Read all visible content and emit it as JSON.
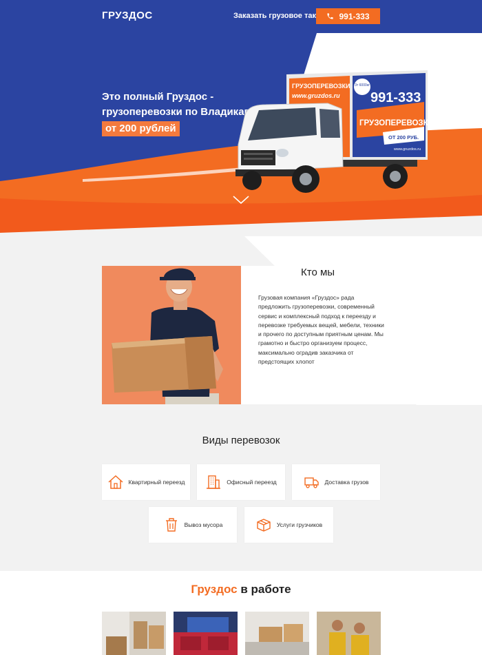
{
  "header": {
    "logo": "ГРУЗДОС",
    "order_link": "Заказать грузовое такси",
    "phone": "991-333"
  },
  "hero": {
    "title_line1": "Это полный Груздос -",
    "title_line2": "грузоперевозки по Владикавказу",
    "price": "от 200 рублей",
    "truck": {
      "side_label": "ГРУЗОПЕРЕВОЗКИ",
      "site": "www.gruzdos.ru",
      "phone": "991-333",
      "big_label": "ГРУЗОПЕРЕВОЗКИ",
      "price": "ОТ 200 РУБ.",
      "site_small": "www.gruzdos.ru",
      "badge": "3т 6000кг"
    }
  },
  "about": {
    "title": "Кто мы",
    "text": "Грузовая компания «Груздос» рада предложить грузоперевозки, современный сервис и комплексный подход к переезду и перевозке требуемых вещей, мебели, техники и прочего по доступным приятным ценам. Мы грамотно и быстро организуем процесс, максимально оградив заказчика от предстоящих хлопот"
  },
  "services": {
    "title": "Виды перевозок",
    "items": [
      {
        "label": "Квартирный переезд",
        "icon": "house-icon"
      },
      {
        "label": "Офисный переезд",
        "icon": "office-building-icon"
      },
      {
        "label": "Доставка грузов",
        "icon": "delivery-truck-icon"
      },
      {
        "label": "Вывоз мусора",
        "icon": "trash-can-icon"
      },
      {
        "label": "Услуги грузчиков",
        "icon": "box-icon"
      }
    ]
  },
  "work": {
    "title_accent": "Груздос",
    "title_rest": " в работе"
  },
  "colors": {
    "brand_blue": "#2b44a1",
    "brand_orange": "#f36c22",
    "light_bg": "#f2f2f2"
  }
}
